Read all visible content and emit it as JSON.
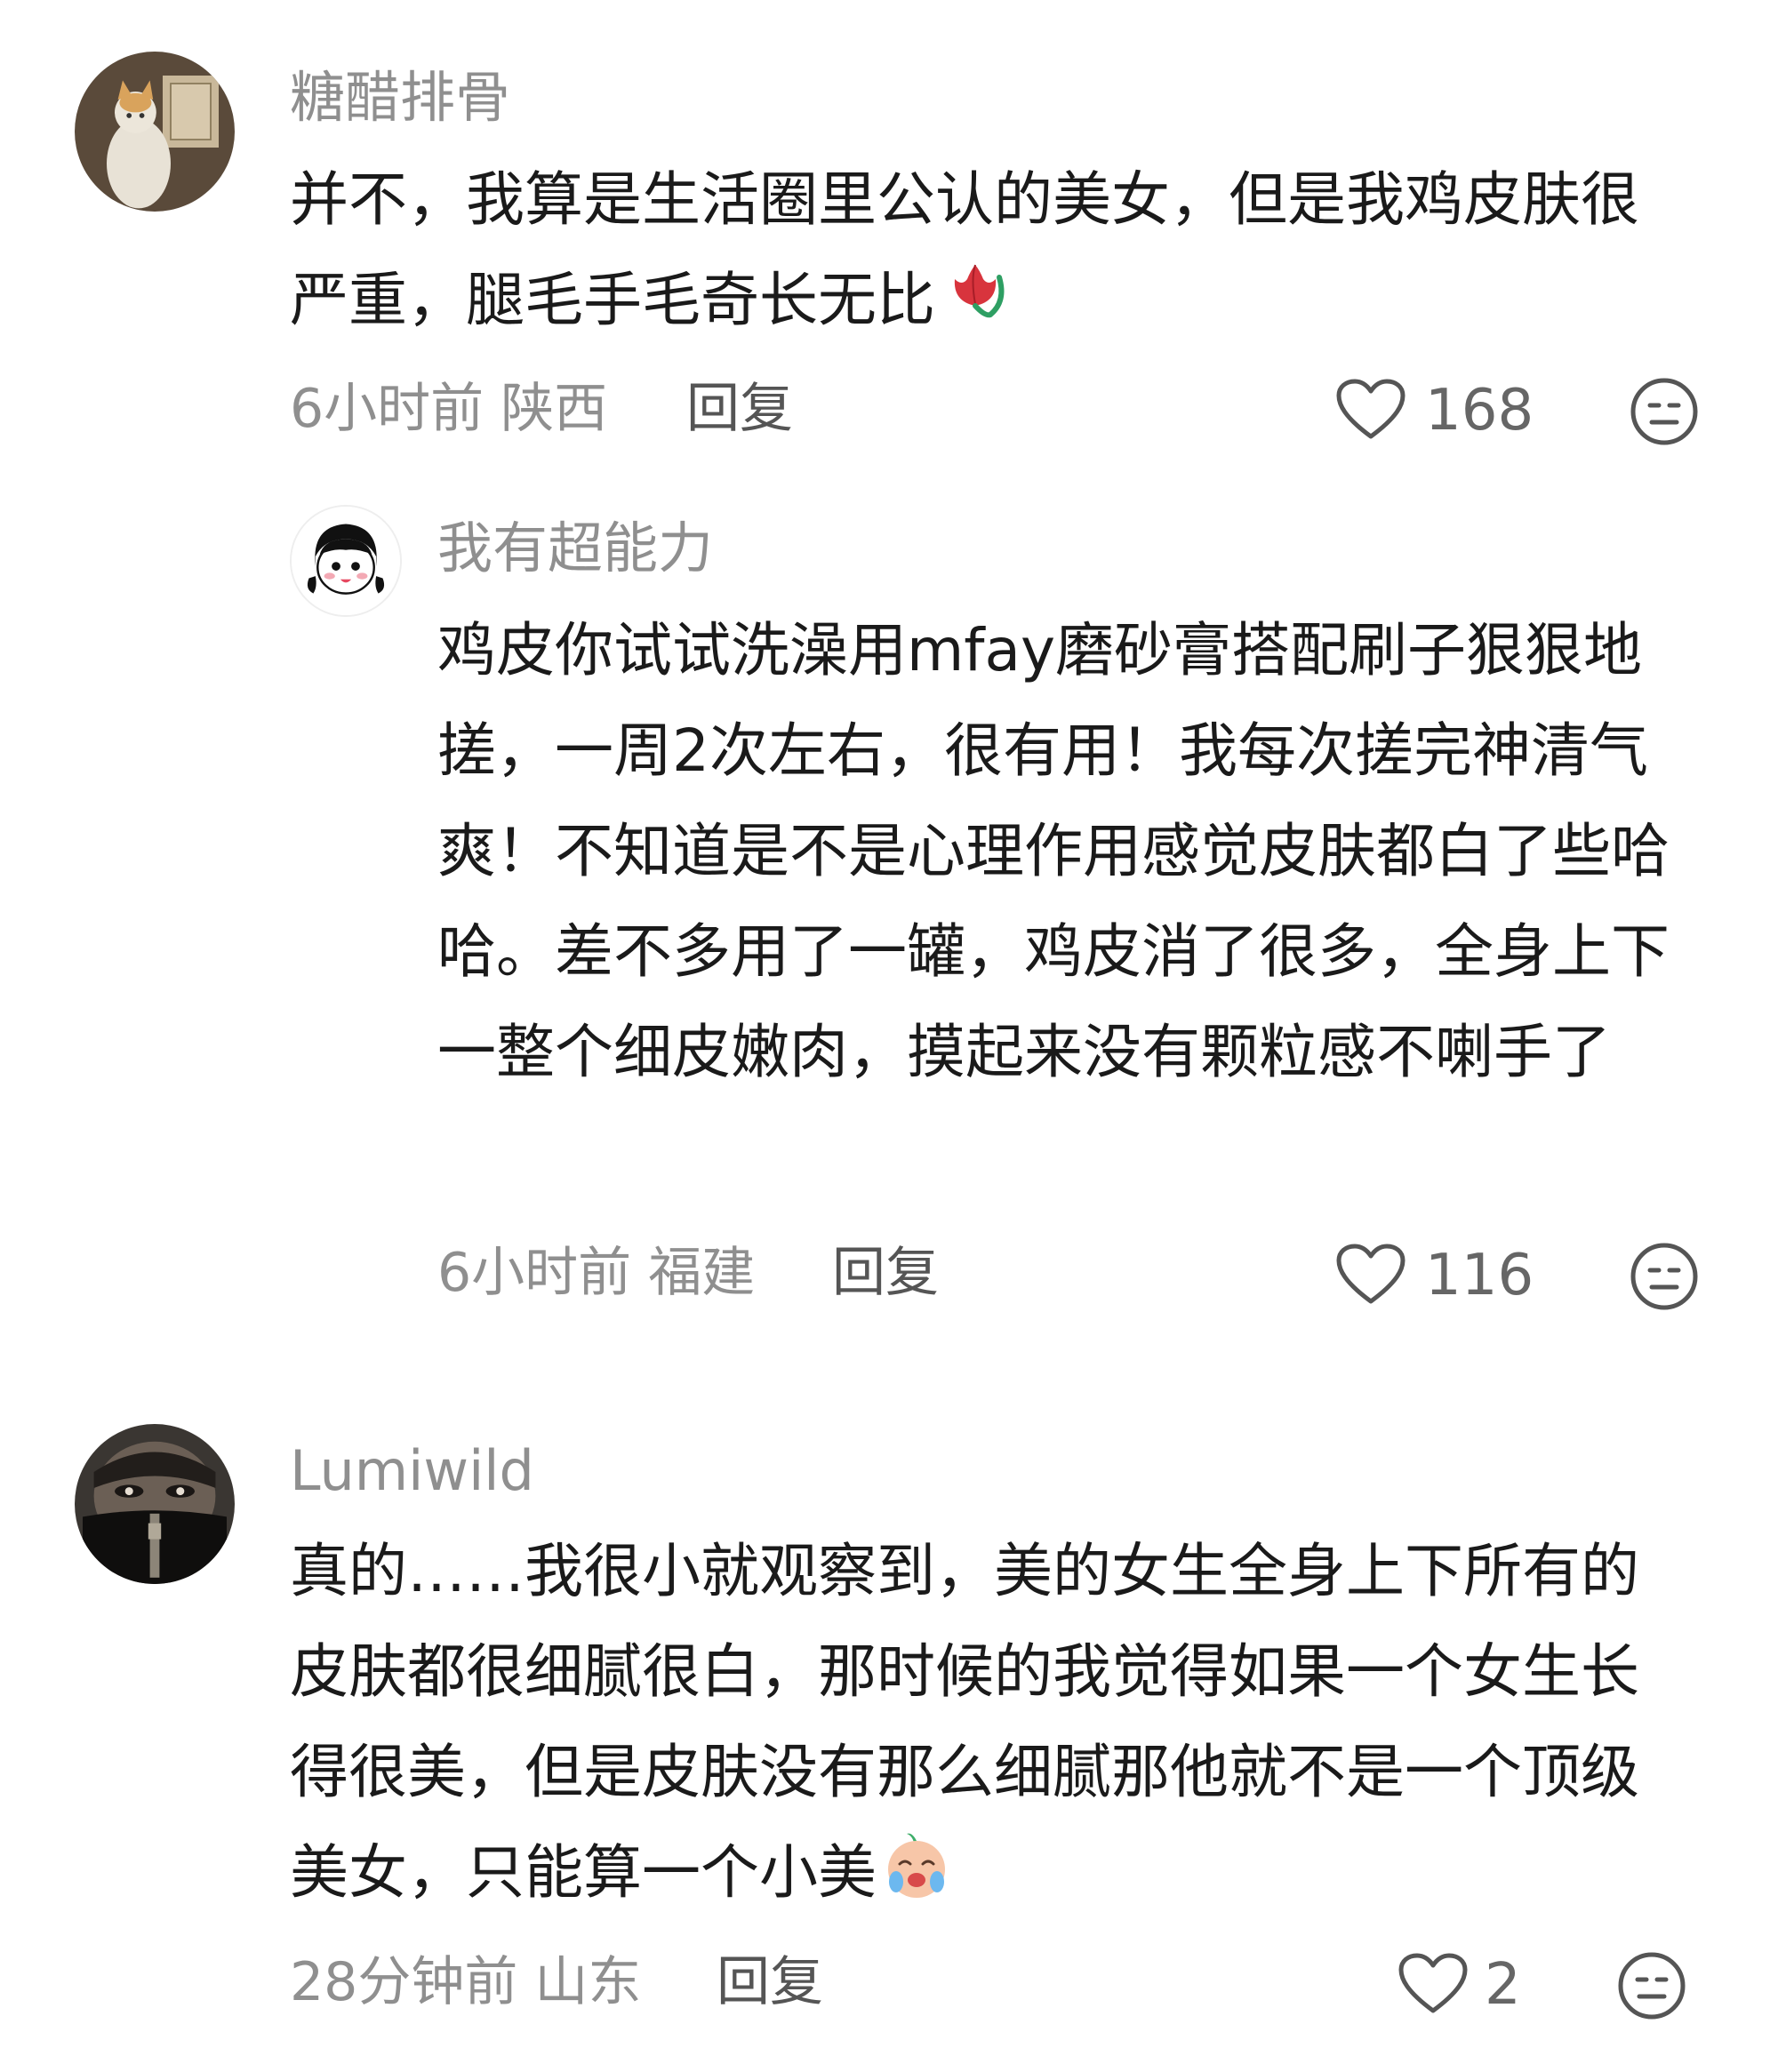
{
  "comments": [
    {
      "username": "糖醋排骨",
      "text": "并不，我算是生活圈里公认的美女，但是我鸡皮肤很严重，腿毛手毛奇长无比",
      "emoji": "tulip",
      "time_location": "6小时前 陕西",
      "reply_label": "回复",
      "likes": "168"
    },
    {
      "username": "我有超能力",
      "text": "鸡皮你试试洗澡用mfay磨砂膏搭配刷子狠狠地搓，一周2次左右，很有用！我每次搓完神清气爽！不知道是不是心理作用感觉皮肤都白了些哈哈。差不多用了一罐，鸡皮消了很多，全身上下一整个细皮嫩肉，摸起来没有颗粒感不喇手了",
      "time_location": "6小时前 福建",
      "reply_label": "回复",
      "likes": "116"
    },
    {
      "username": "Lumiwild",
      "text": "真的……我很小就观察到，美的女生全身上下所有的皮肤都很细腻很白，那时候的我觉得如果一个女生长得很美，但是皮肤没有那么细腻那他就不是一个顶级美女，只能算一个小美",
      "emoji": "crying-face",
      "time_location": "28分钟前 山东",
      "reply_label": "回复",
      "likes": "2"
    }
  ],
  "icons": {
    "like": "heart-outline-icon",
    "react": "meh-face-icon"
  },
  "colors": {
    "username": "#8f8f8f",
    "text": "#1a1a1a",
    "meta": "#8f8f8f",
    "reply": "#555555"
  }
}
